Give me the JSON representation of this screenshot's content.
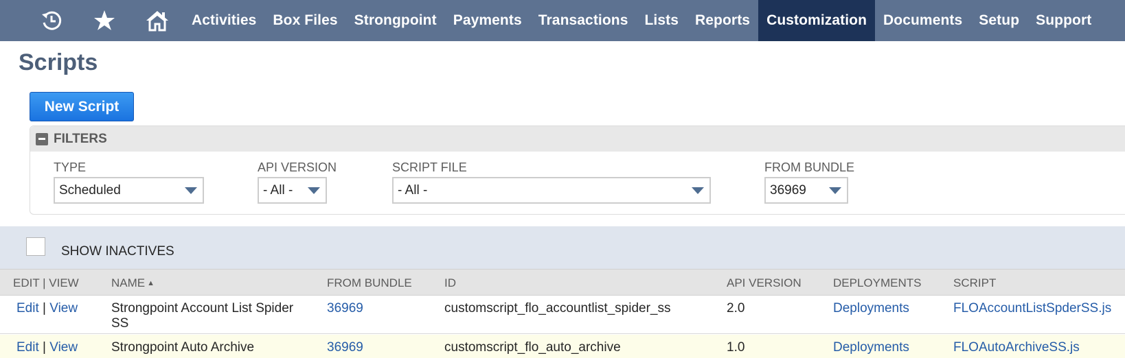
{
  "nav": {
    "icons": [
      "recent-icon",
      "star-icon",
      "home-icon"
    ],
    "items": [
      "Activities",
      "Box Files",
      "Strongpoint",
      "Payments",
      "Transactions",
      "Lists",
      "Reports",
      "Customization",
      "Documents",
      "Setup",
      "Support"
    ],
    "active": "Customization"
  },
  "page": {
    "title": "Scripts"
  },
  "buttons": {
    "new_script": "New Script"
  },
  "filters": {
    "header": "FILTERS",
    "type": {
      "label": "TYPE",
      "value": "Scheduled"
    },
    "api_version": {
      "label": "API VERSION",
      "value": "- All -"
    },
    "script_file": {
      "label": "SCRIPT FILE",
      "value": "- All -"
    },
    "from_bundle": {
      "label": "FROM BUNDLE",
      "value": "36969"
    }
  },
  "show_inactives": {
    "label": "SHOW INACTIVES",
    "checked": false
  },
  "table": {
    "columns": [
      "EDIT | VIEW",
      "NAME",
      "FROM BUNDLE",
      "ID",
      "API VERSION",
      "DEPLOYMENTS",
      "SCRIPT"
    ],
    "sorted_column": "NAME",
    "sort_direction": "ascending",
    "rows": [
      {
        "edit": "Edit",
        "view": "View",
        "sep": "|",
        "name_line1": "Strongpoint Account List Spider",
        "name_line2": "SS",
        "bundle": "36969",
        "id": "customscript_flo_accountlist_spider_ss",
        "api_version": "2.0",
        "deployments": "Deployments",
        "script": "FLOAccountListSpderSS.js"
      },
      {
        "edit": "Edit",
        "view": "View",
        "sep": "|",
        "name_line1": "Strongpoint Auto Archive",
        "name_line2": "",
        "bundle": "36969",
        "id": "customscript_flo_auto_archive",
        "api_version": "1.0",
        "deployments": "Deployments",
        "script": "FLOAutoArchiveSS.js"
      }
    ]
  },
  "colors": {
    "nav_bg": "#5d7291",
    "nav_active": "#1d3358",
    "link": "#255ca8",
    "button": "#2a82ea"
  }
}
